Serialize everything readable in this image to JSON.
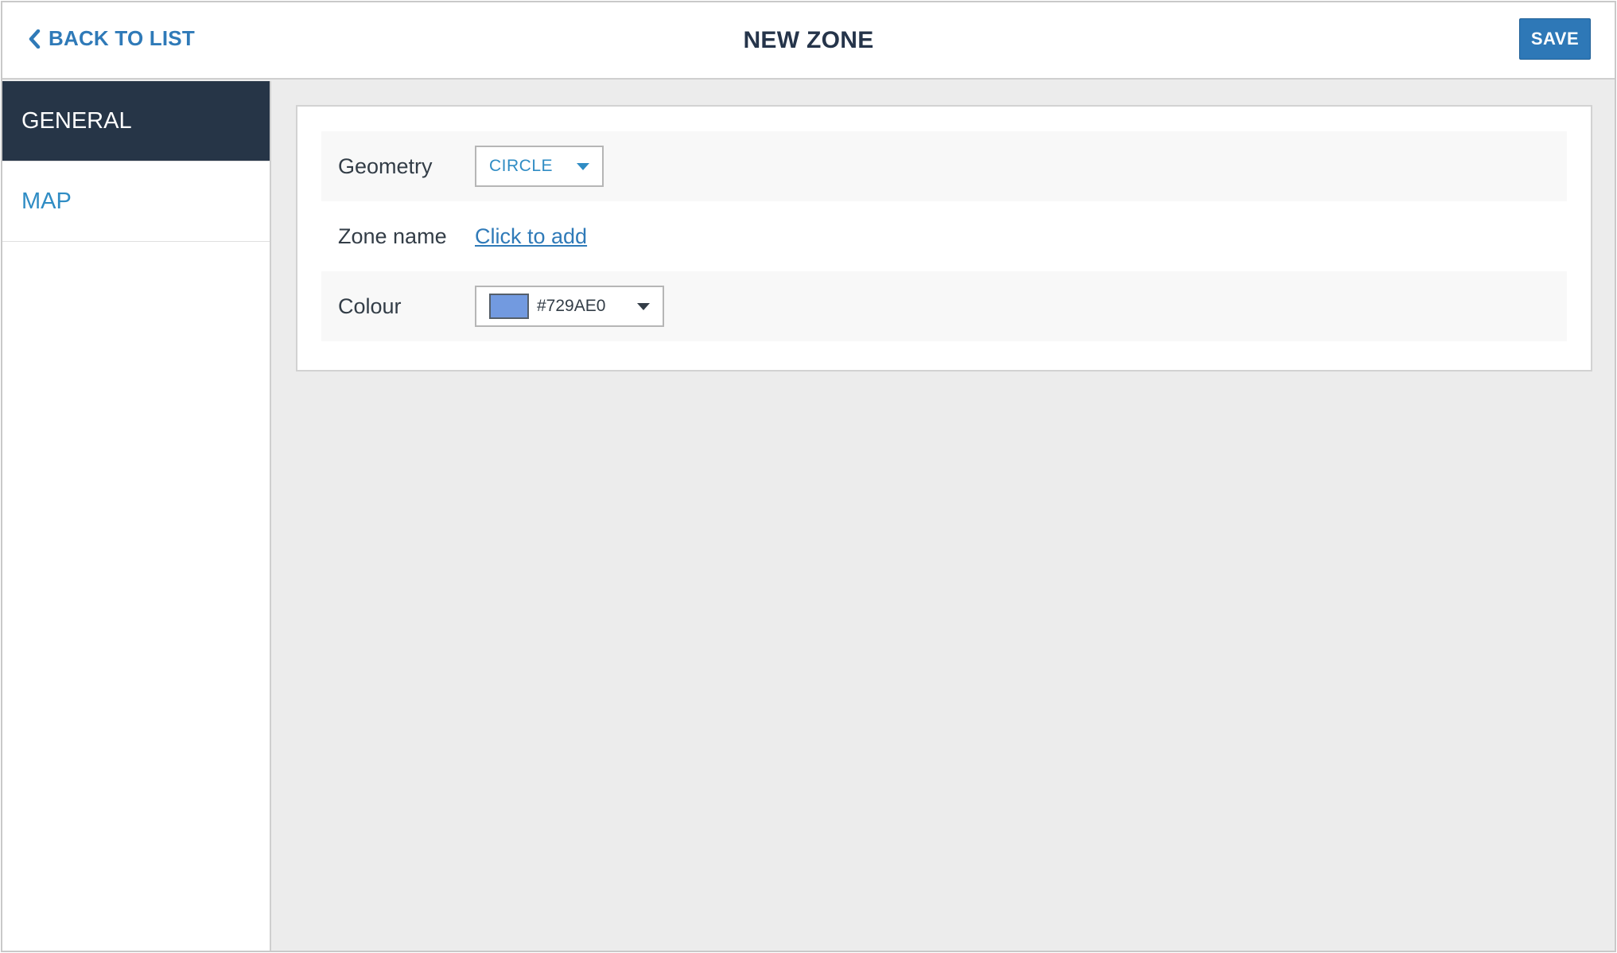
{
  "header": {
    "back_label": "BACK TO LIST",
    "title": "NEW ZONE",
    "save_label": "SAVE"
  },
  "sidebar": {
    "items": [
      {
        "label": "GENERAL",
        "active": true
      },
      {
        "label": "MAP",
        "active": false
      }
    ]
  },
  "form": {
    "geometry": {
      "label": "Geometry",
      "value": "CIRCLE"
    },
    "zone_name": {
      "label": "Zone name",
      "link_text": "Click to add"
    },
    "colour": {
      "label": "Colour",
      "value": "#729AE0",
      "swatch": "#729AE0"
    }
  },
  "icons": {
    "back": "chevron-left-icon",
    "dropdown": "caret-down-icon"
  },
  "colors": {
    "accent": "#2f7ab8",
    "sidebar_active": "#263547",
    "link": "#2f8cc4"
  }
}
